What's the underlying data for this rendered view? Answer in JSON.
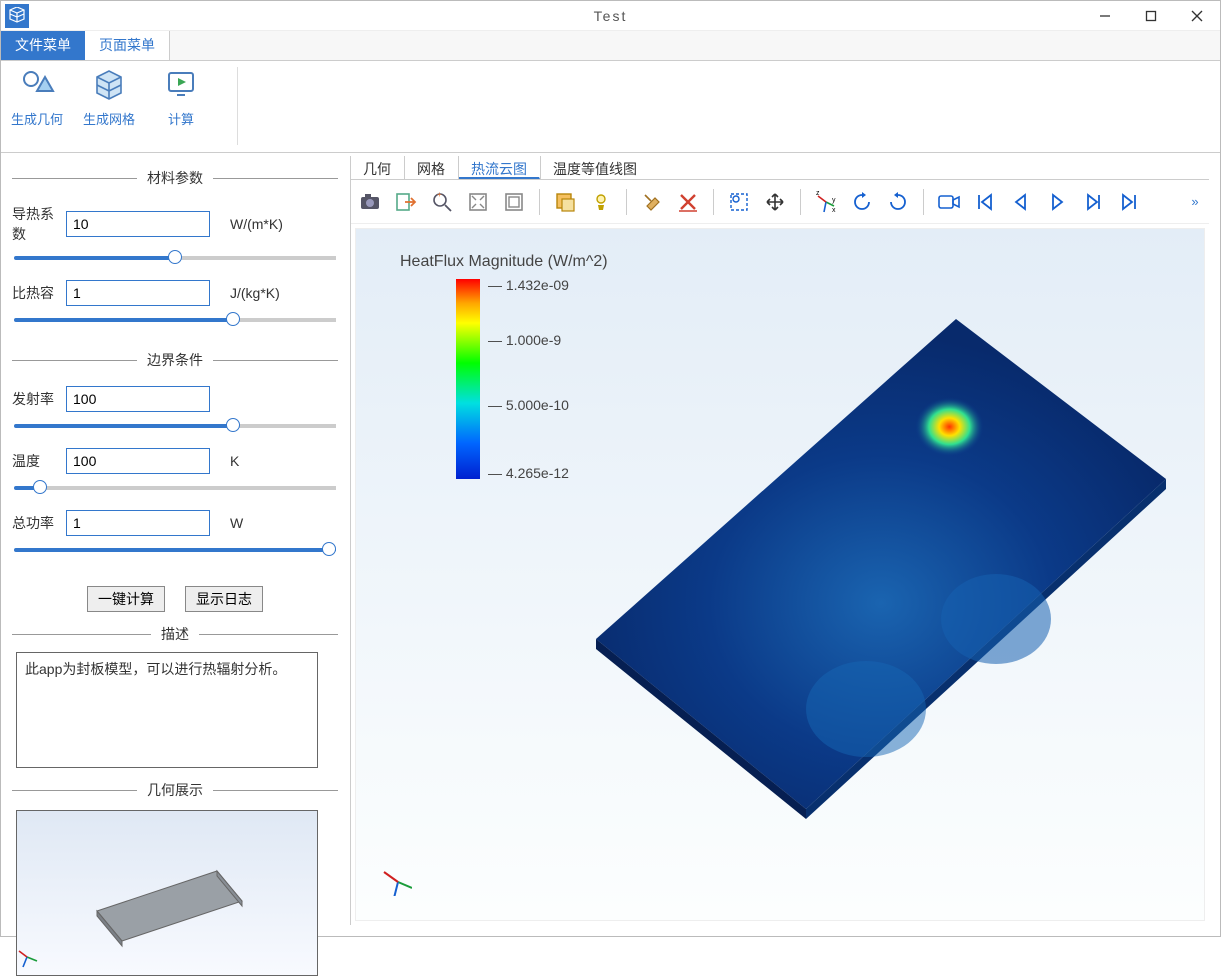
{
  "window": {
    "title": "Test"
  },
  "menu_tabs": [
    {
      "label": "文件菜单",
      "active": true
    },
    {
      "label": "页面菜单",
      "active": false
    }
  ],
  "ribbon": [
    {
      "label": "生成几何"
    },
    {
      "label": "生成网格"
    },
    {
      "label": "计算"
    }
  ],
  "sidebar": {
    "material_title": "材料参数",
    "thermal_cond_label": "导热系数",
    "thermal_cond_value": "10",
    "thermal_cond_unit": "W/(m*K)",
    "specific_heat_label": "比热容",
    "specific_heat_value": "1",
    "specific_heat_unit": "J/(kg*K)",
    "bc_title": "边界条件",
    "emissivity_label": "发射率",
    "emissivity_value": "100",
    "temperature_label": "温度",
    "temperature_value": "100",
    "temperature_unit": "K",
    "power_label": "总功率",
    "power_value": "1",
    "power_unit": "W",
    "compute_btn": "一键计算",
    "log_btn": "显示日志",
    "desc_title": "描述",
    "description": "此app为封板模型，可以进行热辐射分析。",
    "geom_title": "几何展示"
  },
  "viewer": {
    "tabs": [
      {
        "label": "几何"
      },
      {
        "label": "网格"
      },
      {
        "label": "热流云图",
        "active": true
      },
      {
        "label": "温度等值线图"
      }
    ],
    "legend_title": "HeatFlux Magnitude (W/m^2)",
    "legend_max": "1.432e-09",
    "legend_mid1": "1.000e-9",
    "legend_mid2": "5.000e-10",
    "legend_min": "4.265e-12"
  },
  "colors": {
    "accent": "#3377cc"
  }
}
